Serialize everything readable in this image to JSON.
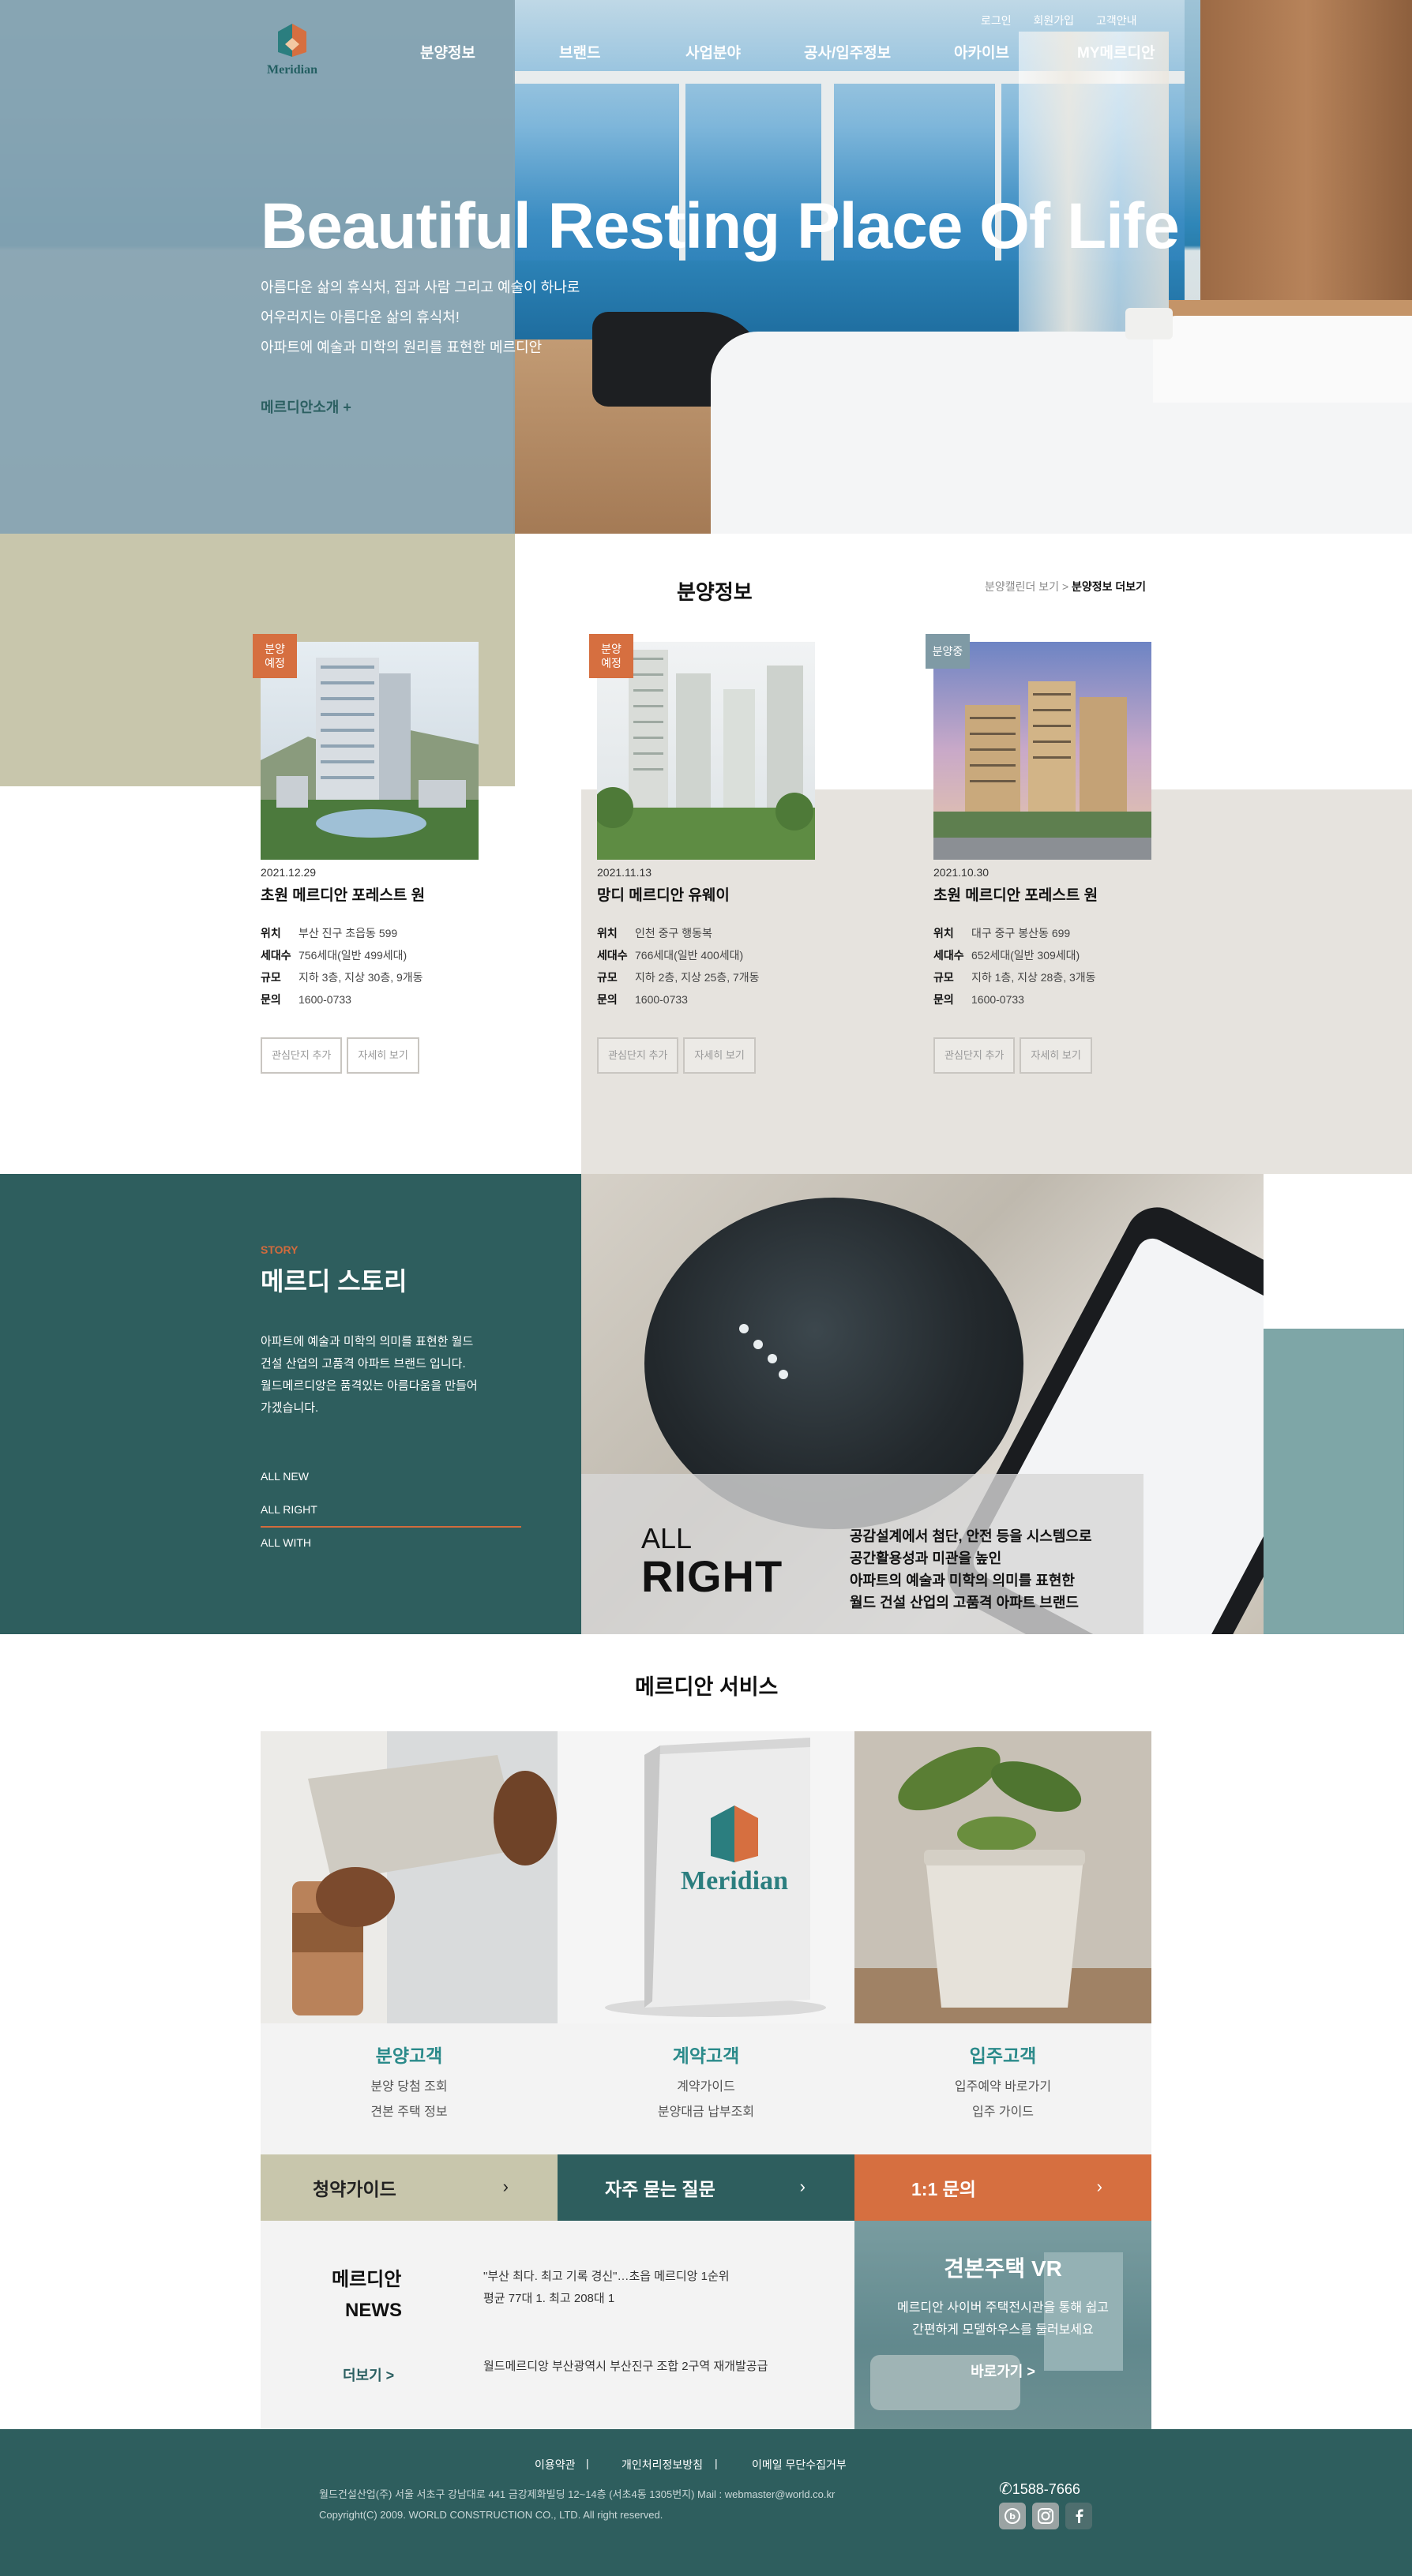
{
  "brand": {
    "logo_text": "Meridian"
  },
  "util_nav": [
    "로그인",
    "회원가입",
    "고객안내"
  ],
  "main_nav": [
    "분양정보",
    "브랜드",
    "사업분야",
    "공사/입주정보",
    "아카이브",
    "MY메르디안"
  ],
  "hero": {
    "title": "Beautiful Resting Place Of Life",
    "lines": [
      "아름다운 삶의 휴식처, 집과 사람 그리고 예술이 하나로",
      "어우러지는 아름다운 삶의 휴식처!",
      "아파트에 예술과 미학의 원리를 표현한 메르디안"
    ],
    "link": "메르디안소개 +"
  },
  "sales": {
    "title": "분양정보",
    "link_calendar": "분양캘린더 보기 >",
    "link_more": "분양정보 더보기",
    "labels": {
      "location": "위치",
      "households": "세대수",
      "scale": "규모",
      "contact": "문의"
    },
    "buttons": {
      "interest": "관심단지 추가",
      "detail": "자세히 보기"
    },
    "items": [
      {
        "badge": "분양\n예정",
        "date": "2021.12.29",
        "name": "초원 메르디안 포레스트 원",
        "location": "부산 진구 초읍동 599",
        "households": "756세대(일반 499세대)",
        "scale": "지하 3층, 지상 30층, 9개동",
        "contact": "1600-0733"
      },
      {
        "badge": "분양\n예정",
        "date": "2021.11.13",
        "name": "망디 메르디안 유웨이",
        "location": "인천 중구 행동복",
        "households": "766세대(일반 400세대)",
        "scale": "지하 2층, 지상 25층, 7개동",
        "contact": "1600-0733"
      },
      {
        "badge": "분양중",
        "date": "2021.10.30",
        "name": "초원 메르디안 포레스트 원",
        "location": "대구 중구 봉산동 699",
        "households": "652세대(일반 309세대)",
        "scale": "지하 1층, 지상 28층, 3개동",
        "contact": "1600-0733"
      }
    ]
  },
  "story": {
    "label": "STORY",
    "title": "메르디 스토리",
    "lines": [
      "아파트에 예술과 미학의 의미를 표현한 월드",
      "건설 산업의 고품격 아파트 브랜드 입니다.",
      "월드메르디앙은 품격있는 아름다움을 만들어",
      "가겠습니다."
    ],
    "menu": [
      "ALL NEW",
      "ALL RIGHT",
      "ALL WITH"
    ],
    "caption_small": "ALL",
    "caption_big": "RIGHT",
    "caption_lines": [
      "공감설계에서 첨단, 안전 등을 시스템으로",
      "공간활용성과 미관을 높인",
      "아파트의 예술과 미학의 의미를 표현한",
      "월드 건설 산업의 고품격 아파트 브랜드"
    ]
  },
  "services": {
    "title": "메르디안 서비스",
    "items": [
      {
        "title": "분양고객",
        "lines": [
          "분양 당첨 조회",
          "견본 주택 정보"
        ]
      },
      {
        "title": "계약고객",
        "lines": [
          "계약가이드",
          "분양대금 납부조회"
        ]
      },
      {
        "title": "입주고객",
        "lines": [
          "입주예약 바로가기",
          "입주 가이드"
        ]
      }
    ],
    "bars": [
      {
        "label": "청약가이드",
        "arrow": "›",
        "color": "#c8c6ac"
      },
      {
        "label": "자주 묻는 질문",
        "arrow": "›",
        "color": "#2e5e5e"
      },
      {
        "label": "1:1 문의",
        "arrow": "›",
        "color": "#d66f40"
      }
    ]
  },
  "news": {
    "heading_1": "메르디안",
    "heading_2": "NEWS",
    "more": "더보기 >",
    "items": [
      "\"부산 최다. 최고 기록 경신\"…초읍 메르디앙 1순위",
      "평균 77대 1. 최고 208대 1",
      "월드메르디앙 부산광역시 부산진구 조합 2구역 재개발공급"
    ]
  },
  "vr": {
    "title": "견본주택 VR",
    "lines": [
      "메르디안 사이버 주택전시관을 통해 쉽고",
      "간편하게 모델하우스를 둘러보세요"
    ],
    "go": "바로가기 >"
  },
  "footer": {
    "links": [
      "이용약관",
      "개인처리정보방침",
      "이메일 무단수집거부"
    ],
    "separator": "|",
    "address": "월드건설산업(주) 서울 서초구 강남대로 441 금강제화빌딩 12~14층 (서초4동 1305번지) Mail : webmaster@world.co.kr",
    "copyright": "Copyright(C) 2009. WORLD CONSTRUCTION CO., LTD. All right reserved.",
    "phone": "1588-7666",
    "sns": [
      "blog-icon",
      "instagram-icon",
      "facebook-icon"
    ]
  },
  "colors": {
    "teal_dark": "#2e5e5e",
    "orange": "#d66f40",
    "beige": "#c8c6ac",
    "gray_bg": "#e6e3de",
    "slate": "#7f9aa5"
  }
}
